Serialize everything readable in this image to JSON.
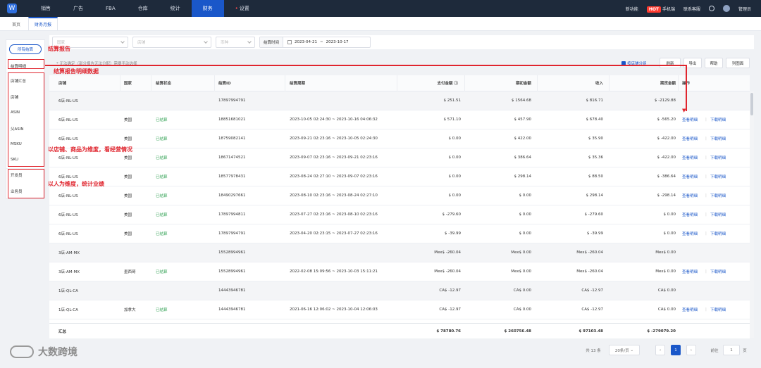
{
  "nav": {
    "logo": "W",
    "items": [
      "销售",
      "广告",
      "FBA",
      "仓库",
      "统计",
      "财务",
      "设置"
    ],
    "active_index": 5,
    "right": {
      "new_feature": "新功能",
      "hot": "HOT",
      "mobile": "手机端",
      "contact": "联系客服",
      "user": "管理员"
    }
  },
  "tabs": [
    "首页",
    "财务月报"
  ],
  "left_menu": {
    "pill": "所有结算",
    "detail": "结算明细",
    "group1": [
      "店铺汇总",
      "店铺",
      "ASIN",
      "父ASIN",
      "MSKU",
      "SKU"
    ],
    "group2": [
      "开发员",
      "业务员"
    ]
  },
  "filters": {
    "select1": "国家",
    "select2": "店铺",
    "select3": "币种",
    "date_label": "结算时间",
    "date_start": "2023-04-21",
    "date_sep": "~",
    "date_end": "2023-10-17"
  },
  "toolbar": {
    "hint": "* 无法确定（部分报告无法分配）需要手动选择",
    "checkbox_label": "按店铺分组",
    "buttons": [
      "刷新",
      "导出",
      "帮助",
      "列图面"
    ]
  },
  "table": {
    "headers": [
      "店铺",
      "国家",
      "结算状态",
      "结算ID",
      "结算周期",
      "支付金额",
      "期初金额",
      "收入",
      "期货金额",
      "操作"
    ],
    "rows": [
      {
        "store": "6店-NL-US",
        "country": "",
        "status": "",
        "id": "17897994791",
        "period": "",
        "pay": "$ 251.51",
        "open": "$ 1564.68",
        "income": "$ 816.71",
        "future": "$ -2129.88",
        "view": "",
        "download": ""
      },
      {
        "store": "6店-NL-US",
        "country": "美国",
        "status": "已结算",
        "id": "18851681021",
        "period": "2023-10-05 02:24:30 ~ 2023-10-16 04:06:32",
        "pay": "$ 571.10",
        "open": "$ 457.90",
        "income": "$ 678.40",
        "future": "$ -565.20",
        "view": "查看明细",
        "download": "下载明细"
      },
      {
        "store": "6店-NL-US",
        "country": "美国",
        "status": "已结算",
        "id": "18759082141",
        "period": "2023-09-21 02:23:16 ~ 2023-10-05 02:24:30",
        "pay": "$ 0.00",
        "open": "$ 422.00",
        "income": "$ 35.90",
        "future": "$ -422.00",
        "view": "查看明细",
        "download": "下载明细"
      },
      {
        "store": "6店-NL-US",
        "country": "美国",
        "status": "已结算",
        "id": "18671474521",
        "period": "2023-09-07 02:23:16 ~ 2023-09-21 02:23:16",
        "pay": "$ 0.00",
        "open": "$ 386.64",
        "income": "$ 35.36",
        "future": "$ -422.00",
        "view": "查看明细",
        "download": "下载明细"
      },
      {
        "store": "6店-NL-US",
        "country": "美国",
        "status": "已结算",
        "id": "18577978431",
        "period": "2023-08-24 02:27:10 ~ 2023-09-07 02:23:16",
        "pay": "$ 0.00",
        "open": "$ 298.14",
        "income": "$ 88.50",
        "future": "$ -386.64",
        "view": "查看明细",
        "download": "下载明细"
      },
      {
        "store": "6店-NL-US",
        "country": "美国",
        "status": "已结算",
        "id": "18490297661",
        "period": "2023-08-10 02:23:16 ~ 2023-08-24 02:27:10",
        "pay": "$ 0.00",
        "open": "$ 0.00",
        "income": "$ 298.14",
        "future": "$ -298.14",
        "view": "查看明细",
        "download": "下载明细"
      },
      {
        "store": "6店-NL-US",
        "country": "美国",
        "status": "已结算",
        "id": "17897994811",
        "period": "2023-07-27 02:23:16 ~ 2023-08-10 02:23:16",
        "pay": "$ -279.60",
        "open": "$ 0.00",
        "income": "$ -279.60",
        "future": "$ 0.00",
        "view": "查看明细",
        "download": "下载明细"
      },
      {
        "store": "6店-NL-US",
        "country": "美国",
        "status": "已结算",
        "id": "17897994791",
        "period": "2023-04-20 02:23:15 ~ 2023-07-27 02:23:16",
        "pay": "$ -39.99",
        "open": "$ 0.00",
        "income": "$ -39.99",
        "future": "$ 0.00",
        "view": "查看明细",
        "download": "下载明细"
      },
      {
        "store": "3店-AM-MX",
        "country": "",
        "status": "",
        "id": "15528994961",
        "period": "",
        "pay": "Mex$ -260.04",
        "open": "Mex$ 0.00",
        "income": "Mex$ -260.04",
        "future": "Mex$ 0.00",
        "view": "",
        "download": ""
      },
      {
        "store": "3店-AM-MX",
        "country": "墨西哥",
        "status": "已结算",
        "id": "15528994961",
        "period": "2022-02-08 15:09:56 ~ 2023-10-03 15:11:21",
        "pay": "Mex$ -260.04",
        "open": "Mex$ 0.00",
        "income": "Mex$ -260.04",
        "future": "Mex$ 0.00",
        "view": "查看明细",
        "download": "下载明细"
      },
      {
        "store": "1店-QL-CA",
        "country": "",
        "status": "",
        "id": "14443946781",
        "period": "",
        "pay": "CA$ -12.97",
        "open": "CA$ 0.00",
        "income": "CA$ -12.97",
        "future": "CA$ 0.00",
        "view": "",
        "download": ""
      },
      {
        "store": "1店-QL-CA",
        "country": "加拿大",
        "status": "已结算",
        "id": "14443946781",
        "period": "2021-06-16 12:06:02 ~ 2023-10-04 12:06:03",
        "pay": "CA$ -12.97",
        "open": "CA$ 0.00",
        "income": "CA$ -12.97",
        "future": "CA$ 0.00",
        "view": "查看明细",
        "download": "下载明细"
      }
    ],
    "total": {
      "label": "汇总",
      "pay": "$ 78780.76",
      "open": "$ 260756.48",
      "income": "$ 97103.48",
      "future": "$ -279079.20"
    }
  },
  "pager": {
    "total": "共 13 条",
    "page_size": "20条/页",
    "current": "1",
    "goto_label": "前往",
    "goto_value": "1",
    "page_unit": "页"
  },
  "annotations": {
    "a1": "结算报告",
    "a2": "结算报告明细数据",
    "a3": "以店铺、商品为维度，看经营情况",
    "a4": "以人为维度，统计业绩"
  },
  "brand": {
    "name": "大数跨境"
  },
  "colors": {
    "nav_bg": "#1e2a3b",
    "accent": "#1a57c9",
    "annotation": "#e0252e",
    "settled": "#3aa55a"
  }
}
